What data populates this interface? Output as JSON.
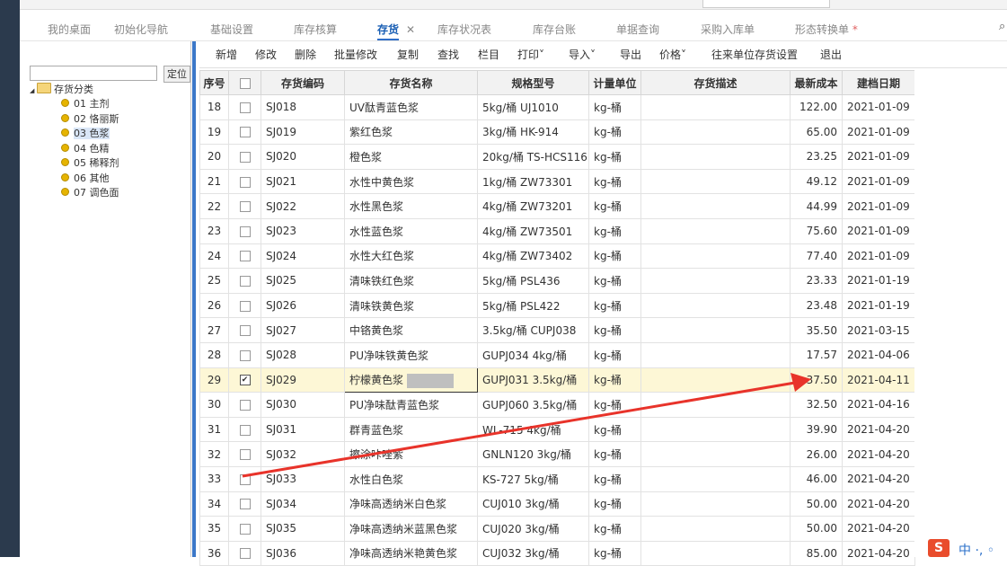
{
  "tabs": [
    {
      "label": "我的桌面",
      "active": false
    },
    {
      "label": "初始化导航",
      "active": false
    },
    {
      "label": "基础设置",
      "active": false
    },
    {
      "label": "库存核算",
      "active": false
    },
    {
      "label": "存货",
      "active": true
    },
    {
      "label": "库存状况表",
      "active": false
    },
    {
      "label": "库存台账",
      "active": false
    },
    {
      "label": "单据查询",
      "active": false
    },
    {
      "label": "采购入库单",
      "active": false
    },
    {
      "label": "形态转换单",
      "active": false,
      "modified_mark": "*"
    }
  ],
  "tab_close_glyph": "✕",
  "tree": {
    "locate_button": "定位",
    "root_label": "存货分类",
    "items": [
      {
        "label": "01 主剂",
        "selected": false
      },
      {
        "label": "02 恪丽斯",
        "selected": false
      },
      {
        "label": "03 色浆",
        "selected": true
      },
      {
        "label": "04 色精",
        "selected": false
      },
      {
        "label": "05 稀释剂",
        "selected": false
      },
      {
        "label": "06 其他",
        "selected": false
      },
      {
        "label": "07 调色面",
        "selected": false
      }
    ]
  },
  "toolbar": [
    {
      "label": "新增"
    },
    {
      "label": "修改"
    },
    {
      "label": "删除"
    },
    {
      "label": "批量修改"
    },
    {
      "label": "复制"
    },
    {
      "label": "查找"
    },
    {
      "label": "栏目"
    },
    {
      "label": "打印",
      "dropdown": true
    },
    {
      "label": "导入",
      "dropdown": true
    },
    {
      "label": "导出"
    },
    {
      "label": "价格",
      "dropdown": true
    },
    {
      "label": "往来单位存货设置"
    },
    {
      "label": "退出"
    }
  ],
  "table": {
    "columns": [
      "序号",
      "",
      "存货编码",
      "存货名称",
      "规格型号",
      "计量单位",
      "存货描述",
      "最新成本",
      "建档日期"
    ],
    "rows": [
      {
        "idx": "18",
        "checked": false,
        "code": "SJ018",
        "name": "UV酞青蓝色浆",
        "spec": "5kg/桶 UJ1010",
        "unit": "kg-桶",
        "desc": "",
        "cost": "122.00",
        "date": "2021-01-09"
      },
      {
        "idx": "19",
        "checked": false,
        "code": "SJ019",
        "name": "紫红色浆",
        "spec": "3kg/桶 HK-914",
        "unit": "kg-桶",
        "desc": "",
        "cost": "65.00",
        "date": "2021-01-09"
      },
      {
        "idx": "20",
        "checked": false,
        "code": "SJ020",
        "name": "橙色浆",
        "spec": "20kg/桶 TS-HCS116",
        "unit": "kg-桶",
        "desc": "",
        "cost": "23.25",
        "date": "2021-01-09"
      },
      {
        "idx": "21",
        "checked": false,
        "code": "SJ021",
        "name": "水性中黄色浆",
        "spec": "1kg/桶 ZW73301",
        "unit": "kg-桶",
        "desc": "",
        "cost": "49.12",
        "date": "2021-01-09"
      },
      {
        "idx": "22",
        "checked": false,
        "code": "SJ022",
        "name": "水性黑色浆",
        "spec": "4kg/桶 ZW73201",
        "unit": "kg-桶",
        "desc": "",
        "cost": "44.99",
        "date": "2021-01-09"
      },
      {
        "idx": "23",
        "checked": false,
        "code": "SJ023",
        "name": "水性蓝色浆",
        "spec": "4kg/桶 ZW73501",
        "unit": "kg-桶",
        "desc": "",
        "cost": "75.60",
        "date": "2021-01-09"
      },
      {
        "idx": "24",
        "checked": false,
        "code": "SJ024",
        "name": "水性大红色浆",
        "spec": "4kg/桶 ZW73402",
        "unit": "kg-桶",
        "desc": "",
        "cost": "77.40",
        "date": "2021-01-09"
      },
      {
        "idx": "25",
        "checked": false,
        "code": "SJ025",
        "name": "清味铁红色浆",
        "spec": "5kg/桶  PSL436",
        "unit": "kg-桶",
        "desc": "",
        "cost": "23.33",
        "date": "2021-01-19"
      },
      {
        "idx": "26",
        "checked": false,
        "code": "SJ026",
        "name": "清味铁黄色浆",
        "spec": "5kg/桶  PSL422",
        "unit": "kg-桶",
        "desc": "",
        "cost": "23.48",
        "date": "2021-01-19"
      },
      {
        "idx": "27",
        "checked": false,
        "code": "SJ027",
        "name": "中铬黄色浆",
        "spec": "3.5kg/桶  CUPJ038",
        "unit": "kg-桶",
        "desc": "",
        "cost": "35.50",
        "date": "2021-03-15"
      },
      {
        "idx": "28",
        "checked": false,
        "code": "SJ028",
        "name": "PU净味铁黄色浆",
        "spec": "GUPJ034  4kg/桶",
        "unit": "kg-桶",
        "desc": "",
        "cost": "17.57",
        "date": "2021-04-06"
      },
      {
        "idx": "29",
        "checked": true,
        "selected": true,
        "editing": true,
        "code": "SJ029",
        "name": "柠檬黄色浆",
        "spec": "GUPJ031  3.5kg/桶",
        "unit": "kg-桶",
        "desc": "",
        "cost": "37.50",
        "date": "2021-04-11"
      },
      {
        "idx": "30",
        "checked": false,
        "code": "SJ030",
        "name": "PU净味酞青蓝色浆",
        "spec": "GUPJ060  3.5kg/桶",
        "unit": "kg-桶",
        "desc": "",
        "cost": "32.50",
        "date": "2021-04-16"
      },
      {
        "idx": "31",
        "checked": false,
        "code": "SJ031",
        "name": "群青蓝色浆",
        "spec": "WL-715  4kg/桶",
        "unit": "kg-桶",
        "desc": "",
        "cost": "39.90",
        "date": "2021-04-20"
      },
      {
        "idx": "32",
        "checked": false,
        "code": "SJ032",
        "name": "擦涂咔唑紫",
        "spec": "GNLN120  3kg/桶",
        "unit": "kg-桶",
        "desc": "",
        "cost": "26.00",
        "date": "2021-04-20"
      },
      {
        "idx": "33",
        "checked": false,
        "code": "SJ033",
        "name": "水性白色浆",
        "spec": "KS-727  5kg/桶",
        "unit": "kg-桶",
        "desc": "",
        "cost": "46.00",
        "date": "2021-04-20"
      },
      {
        "idx": "34",
        "checked": false,
        "code": "SJ034",
        "name": "净味高透纳米白色浆",
        "spec": "CUJ010  3kg/桶",
        "unit": "kg-桶",
        "desc": "",
        "cost": "50.00",
        "date": "2021-04-20"
      },
      {
        "idx": "35",
        "checked": false,
        "code": "SJ035",
        "name": "净味高透纳米蓝黑色浆",
        "spec": "CUJ020  3kg/桶",
        "unit": "kg-桶",
        "desc": "",
        "cost": "50.00",
        "date": "2021-04-20"
      },
      {
        "idx": "36",
        "checked": false,
        "code": "SJ036",
        "name": "净味高透纳米艳黄色浆",
        "spec": "CUJ032  3kg/桶",
        "unit": "kg-桶",
        "desc": "",
        "cost": "85.00",
        "date": "2021-04-20"
      }
    ]
  },
  "ime": {
    "logo": "S",
    "text": "中 ·, ◦"
  },
  "colors": {
    "accent": "#2f6ec9",
    "selected_row": "#fdf7d6",
    "annotation_arrow": "#e8332a",
    "splitter": "#3c78c8"
  }
}
